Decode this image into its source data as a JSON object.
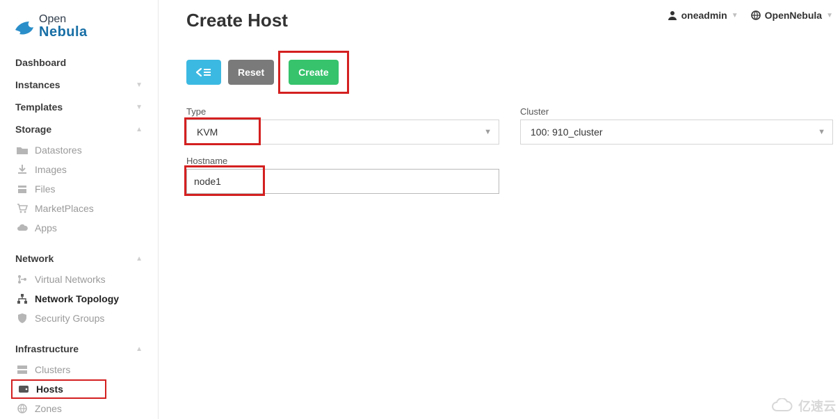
{
  "brand": {
    "line1": "Open",
    "line2": "Nebula"
  },
  "topbar": {
    "user": "oneadmin",
    "zone": "OpenNebula"
  },
  "page": {
    "title": "Create Host"
  },
  "buttons": {
    "reset": "Reset",
    "create": "Create"
  },
  "form": {
    "type_label": "Type",
    "type_value": "KVM",
    "cluster_label": "Cluster",
    "cluster_value": "100: 910_cluster",
    "hostname_label": "Hostname",
    "hostname_value": "node1"
  },
  "sidebar": {
    "sections": {
      "dashboard": "Dashboard",
      "instances": "Instances",
      "templates": "Templates",
      "storage": "Storage",
      "storage_items": {
        "datastores": "Datastores",
        "images": "Images",
        "files": "Files",
        "marketplaces": "MarketPlaces",
        "apps": "Apps"
      },
      "network": "Network",
      "network_items": {
        "virtual_networks": "Virtual Networks",
        "network_topology": "Network Topology",
        "security_groups": "Security Groups"
      },
      "infrastructure": "Infrastructure",
      "infrastructure_items": {
        "clusters": "Clusters",
        "hosts": "Hosts",
        "zones": "Zones"
      }
    }
  },
  "watermark": "亿速云"
}
